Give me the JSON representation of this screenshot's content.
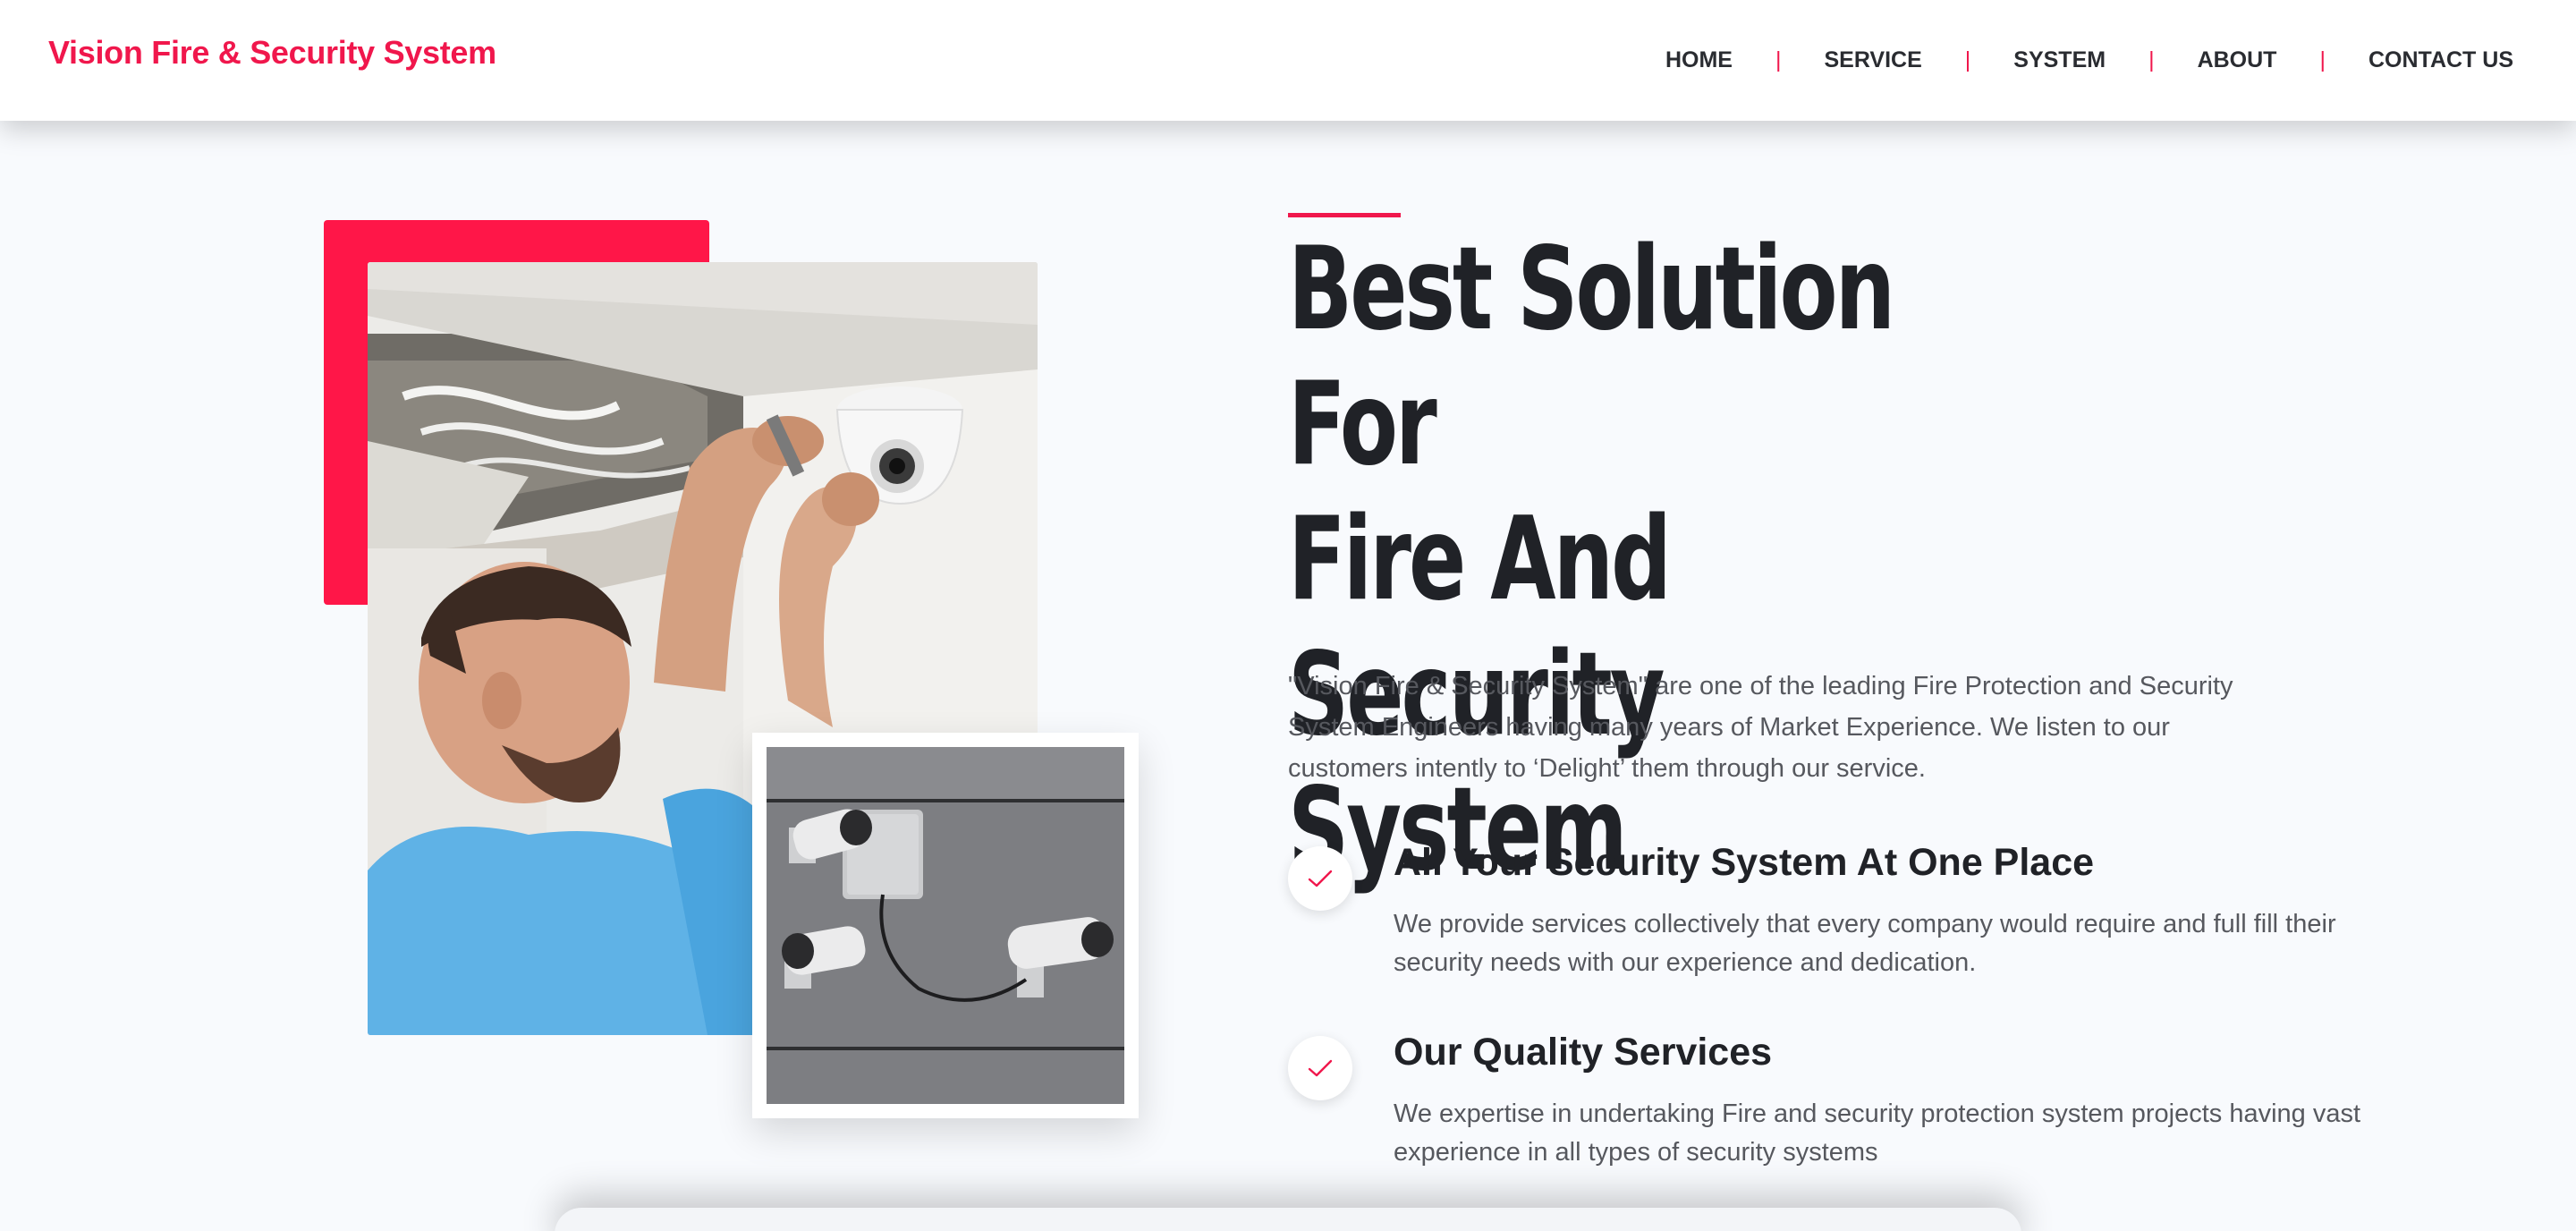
{
  "brand": {
    "name": "Vision Fire & Security System",
    "color": "#f0174c"
  },
  "nav": {
    "items": [
      {
        "label": "HOME"
      },
      {
        "label": "SERVICE"
      },
      {
        "label": "SYSTEM"
      },
      {
        "label": "ABOUT"
      },
      {
        "label": "CONTACT US"
      }
    ],
    "separator": "|"
  },
  "hero": {
    "title_lines": [
      "Best Solution For",
      "Fire And Security",
      "System"
    ],
    "description": "\"Vision Fire & Security System\" are one of the leading Fire Protection and Security System Engineers having many years of Market Experience. We listen to our customers intently to ‘Delight’ them through our service.",
    "images": {
      "main": "technician installing dome security camera",
      "secondary": "three cctv bullet cameras with junction box"
    }
  },
  "features": [
    {
      "icon": "check-icon",
      "title": "All Your Security System At One Place",
      "text": "We provide services collectively that every company would require and full fill their security needs with our experience and dedication."
    },
    {
      "icon": "check-icon",
      "title": "Our Quality Services",
      "text": "We expertise in undertaking Fire and security protection system projects having vast experience in all types of security systems"
    }
  ],
  "colors": {
    "accent": "#f0174c",
    "accent_block": "#ff1648",
    "background": "#f8fafd",
    "heading": "#202227",
    "body_text": "#56585e"
  }
}
